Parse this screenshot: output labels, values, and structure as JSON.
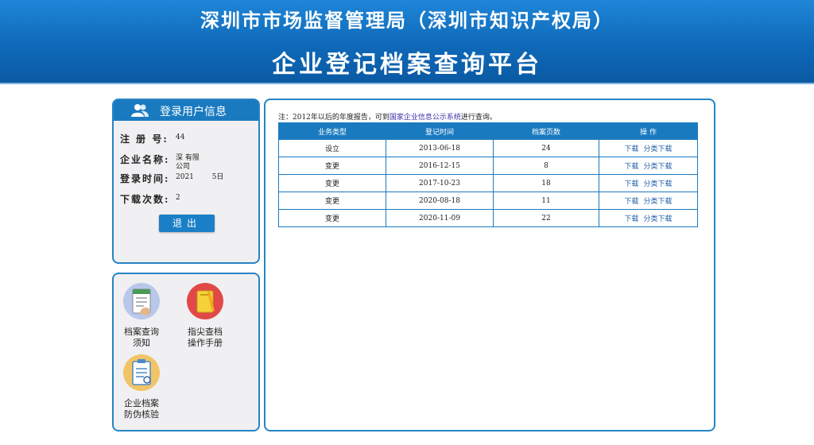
{
  "header": {
    "title_line1": "深圳市市场监督管理局（深圳市知识产权局）",
    "title_line2": "企业登记档案查询平台"
  },
  "user_panel": {
    "title": "登录用户信息",
    "reg_no_label": "注 册 号:",
    "reg_no_value": "44",
    "company_label": "企业名称:",
    "company_value": "深    有限\n公司",
    "login_time_label": "登录时间:",
    "login_time_value": "2021        5日",
    "downloads_label": "下载次数:",
    "downloads_value": "2",
    "logout_label": "退出"
  },
  "tools": [
    {
      "label": "档案查询\n须知",
      "icon": "document-checklist-icon"
    },
    {
      "label": "指尖查档\n操作手册",
      "icon": "manual-book-icon"
    },
    {
      "label": "企业档案\n防伪核验",
      "icon": "clipboard-verify-icon"
    }
  ],
  "main": {
    "note_prefix": "注：2012年以后的年度报告，可到",
    "note_link": "国家企业信息公示系统",
    "note_suffix": "进行查询。",
    "columns": [
      "业务类型",
      "登记时间",
      "档案页数",
      "操  作"
    ],
    "download_label": "下载",
    "category_download_label": "分类下载",
    "rows": [
      {
        "type": "设立",
        "date": "2013-06-18",
        "pages": "24"
      },
      {
        "type": "变更",
        "date": "2016-12-15",
        "pages": "8"
      },
      {
        "type": "变更",
        "date": "2017-10-23",
        "pages": "18"
      },
      {
        "type": "变更",
        "date": "2020-08-18",
        "pages": "11"
      },
      {
        "type": "变更",
        "date": "2020-11-09",
        "pages": "22"
      }
    ]
  },
  "colors": {
    "header_blue": "#0f69b8",
    "accent_blue": "#1a7ac0",
    "panel_bg": "#f0f0f2",
    "link_purple": "#3a2fa8"
  }
}
